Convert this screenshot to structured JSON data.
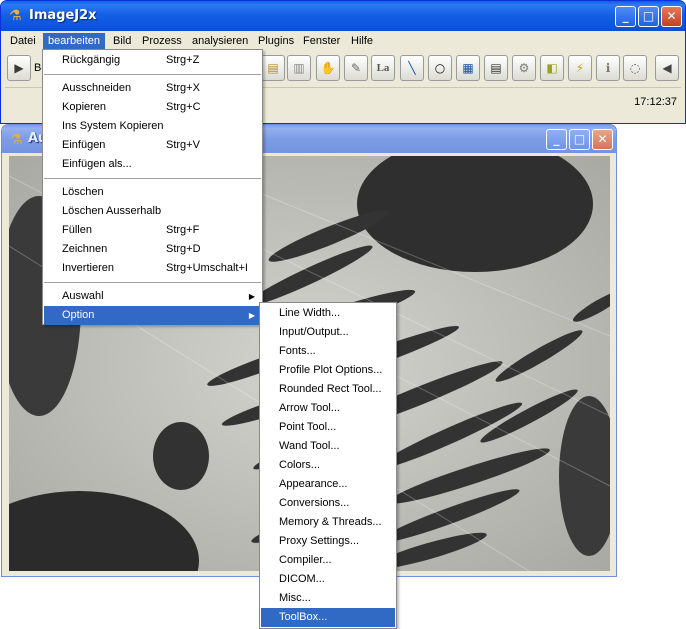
{
  "main_window": {
    "title": "ImageJ2x",
    "menubar": [
      "Datei",
      "bearbeiten",
      "Bild",
      "Prozess",
      "analysieren",
      "Plugins",
      "Fenster",
      "Hilfe"
    ],
    "active_menu": "bearbeiten",
    "toolbar_partial_label": "Be",
    "status_time": "17:12:37"
  },
  "image_window": {
    "title_partial": "Au"
  },
  "edit_menu": {
    "items": [
      {
        "label": "Rückgängig",
        "shortcut": "Strg+Z"
      },
      {
        "label": "Ausschneiden",
        "shortcut": "Strg+X"
      },
      {
        "label": "Kopieren",
        "shortcut": "Strg+C"
      },
      {
        "label": "Ins System Kopieren",
        "shortcut": ""
      },
      {
        "label": "Einfügen",
        "shortcut": "Strg+V"
      },
      {
        "label": "Einfügen als...",
        "shortcut": ""
      },
      {
        "label": "Löschen",
        "shortcut": ""
      },
      {
        "label": "Löschen Ausserhalb",
        "shortcut": ""
      },
      {
        "label": "Füllen",
        "shortcut": "Strg+F"
      },
      {
        "label": "Zeichnen",
        "shortcut": "Strg+D"
      },
      {
        "label": "Invertieren",
        "shortcut": "Strg+Umschalt+I"
      },
      {
        "label": "Auswahl",
        "shortcut": ""
      },
      {
        "label": "Option",
        "shortcut": ""
      }
    ],
    "highlighted": "Option"
  },
  "option_submenu": {
    "items": [
      "Line Width...",
      "Input/Output...",
      "Fonts...",
      "Profile Plot Options...",
      "Rounded Rect Tool...",
      "Arrow Tool...",
      "Point Tool...",
      "Wand Tool...",
      "Colors...",
      "Appearance...",
      "Conversions...",
      "Memory & Threads...",
      "Proxy Settings...",
      "Compiler...",
      "DICOM...",
      "Misc...",
      "ToolBox..."
    ],
    "highlighted": "ToolBox..."
  },
  "colors": {
    "titlebar_active": "#0a5fe8",
    "titlebar_inactive": "#7d9ce6",
    "menu_highlight": "#316ac5",
    "window_face": "#ece9d8"
  }
}
